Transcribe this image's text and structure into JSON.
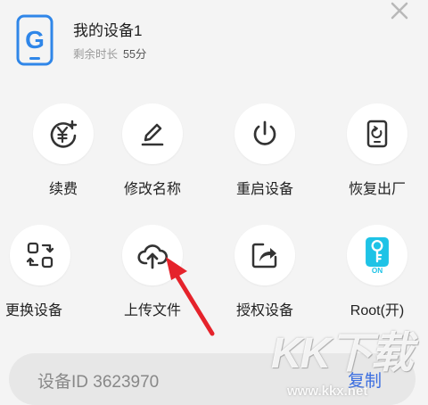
{
  "device": {
    "name": "我的设备1",
    "remaining_label": "剩余时长",
    "remaining_value": "55分"
  },
  "actions": [
    {
      "label": "续费",
      "icon": "renew-yen-icon"
    },
    {
      "label": "修改名称",
      "icon": "edit-pen-icon"
    },
    {
      "label": "重启设备",
      "icon": "power-icon"
    },
    {
      "label": "恢复出厂",
      "icon": "factory-reset-icon"
    },
    {
      "label": "更换设备",
      "icon": "swap-device-icon"
    },
    {
      "label": "上传文件",
      "icon": "cloud-upload-icon"
    },
    {
      "label": "授权设备",
      "icon": "share-authorize-icon"
    },
    {
      "label": "Root(开)",
      "icon": "root-key-icon",
      "badge": "ON"
    }
  ],
  "device_id_bar": {
    "id_text": "设备ID 3623970",
    "copy_label": "复制"
  },
  "watermark": {
    "big": "KK下载",
    "small": "www.kkx.net"
  },
  "colors": {
    "accent_blue": "#2f86e8",
    "root_cyan": "#1ec3e6",
    "arrow_red": "#e5232b",
    "copy_blue": "#3a6de0"
  }
}
